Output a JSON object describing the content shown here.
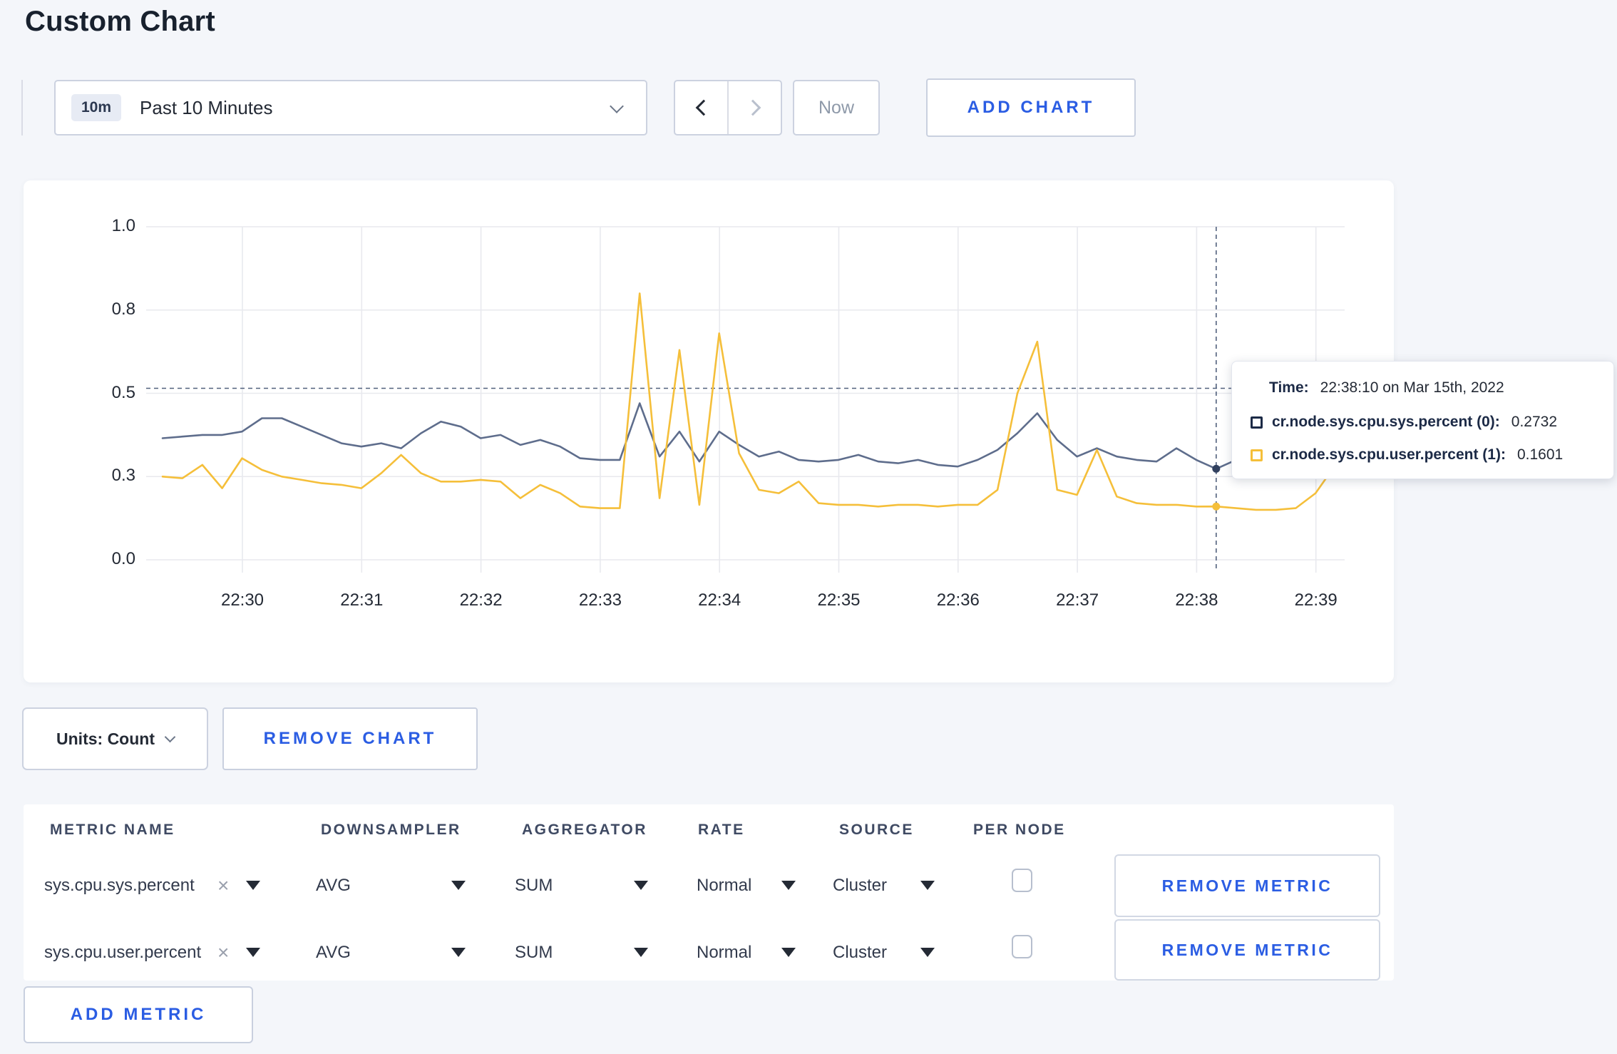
{
  "page": {
    "title": "Custom Chart",
    "background": "#f4f6fa",
    "accent_blue": "#2b5de3"
  },
  "toolbar": {
    "time_window": {
      "badge": "10m",
      "label": "Past 10 Minutes"
    },
    "now_label": "Now",
    "add_chart_label": "ADD CHART"
  },
  "chart_data": {
    "type": "line",
    "x_start": "22:29:20",
    "x_step_seconds": 10,
    "x_tick_labels": [
      "22:30",
      "22:31",
      "22:32",
      "22:33",
      "22:34",
      "22:35",
      "22:36",
      "22:37",
      "22:38",
      "22:39"
    ],
    "y_tick_labels": [
      "0.0",
      "0.3",
      "0.5",
      "0.8",
      "1.0"
    ],
    "y_tick_values": [
      0,
      0.25,
      0.5,
      0.75,
      1.0
    ],
    "ylim": [
      0,
      1
    ],
    "grid": true,
    "series": [
      {
        "name": "cr.node.sys.cpu.sys.percent",
        "color": "#5e6d8c",
        "values": [
          0.365,
          0.37,
          0.375,
          0.375,
          0.385,
          0.425,
          0.425,
          0.4,
          0.375,
          0.35,
          0.34,
          0.35,
          0.335,
          0.38,
          0.415,
          0.4,
          0.365,
          0.375,
          0.345,
          0.36,
          0.34,
          0.305,
          0.3,
          0.3,
          0.47,
          0.31,
          0.385,
          0.295,
          0.385,
          0.345,
          0.31,
          0.325,
          0.3,
          0.295,
          0.3,
          0.315,
          0.295,
          0.29,
          0.3,
          0.285,
          0.28,
          0.3,
          0.33,
          0.38,
          0.44,
          0.36,
          0.31,
          0.335,
          0.31,
          0.3,
          0.295,
          0.335,
          0.3,
          0.2732,
          0.3,
          0.31,
          0.295,
          0.32,
          0.285,
          0.3,
          0.31
        ]
      },
      {
        "name": "cr.node.sys.cpu.user.percent",
        "color": "#f5bf3a",
        "values": [
          0.25,
          0.245,
          0.285,
          0.215,
          0.305,
          0.27,
          0.25,
          0.24,
          0.23,
          0.225,
          0.215,
          0.26,
          0.315,
          0.26,
          0.235,
          0.235,
          0.24,
          0.235,
          0.185,
          0.225,
          0.2,
          0.16,
          0.155,
          0.155,
          0.8,
          0.185,
          0.63,
          0.165,
          0.68,
          0.32,
          0.21,
          0.2,
          0.235,
          0.17,
          0.165,
          0.165,
          0.16,
          0.165,
          0.165,
          0.16,
          0.165,
          0.165,
          0.21,
          0.5,
          0.655,
          0.21,
          0.195,
          0.33,
          0.19,
          0.17,
          0.165,
          0.165,
          0.16,
          0.1601,
          0.155,
          0.15,
          0.15,
          0.155,
          0.2,
          0.285,
          0.295
        ]
      }
    ],
    "crosshair": {
      "time": "22:38:10",
      "x_index": 53,
      "y_value": 0.515,
      "color": "#51607d",
      "dot_colors": [
        "#31405f",
        "#f5bf3a"
      ]
    },
    "tooltip": {
      "time_label": "Time:",
      "time_value": "22:38:10 on Mar 15th, 2022",
      "rows": [
        {
          "label": "cr.node.sys.cpu.sys.percent (0):",
          "value": "0.2732",
          "swatch_color": "#1c2a46"
        },
        {
          "label": "cr.node.sys.cpu.user.percent (1):",
          "value": "0.1601",
          "swatch_color": "#f5bf3a"
        }
      ]
    }
  },
  "units_bar": {
    "units_label": "Units: Count",
    "remove_chart_label": "REMOVE CHART"
  },
  "metrics_table": {
    "headers": [
      "METRIC NAME",
      "DOWNSAMPLER",
      "AGGREGATOR",
      "RATE",
      "SOURCE",
      "PER NODE"
    ],
    "rows": [
      {
        "metric": "sys.cpu.sys.percent",
        "downsampler": "AVG",
        "aggregator": "SUM",
        "rate": "Normal",
        "source": "Cluster",
        "per_node_checked": false,
        "remove_label": "REMOVE METRIC"
      },
      {
        "metric": "sys.cpu.user.percent",
        "downsampler": "AVG",
        "aggregator": "SUM",
        "rate": "Normal",
        "source": "Cluster",
        "per_node_checked": false,
        "remove_label": "REMOVE METRIC"
      }
    ],
    "add_metric_label": "ADD METRIC"
  }
}
